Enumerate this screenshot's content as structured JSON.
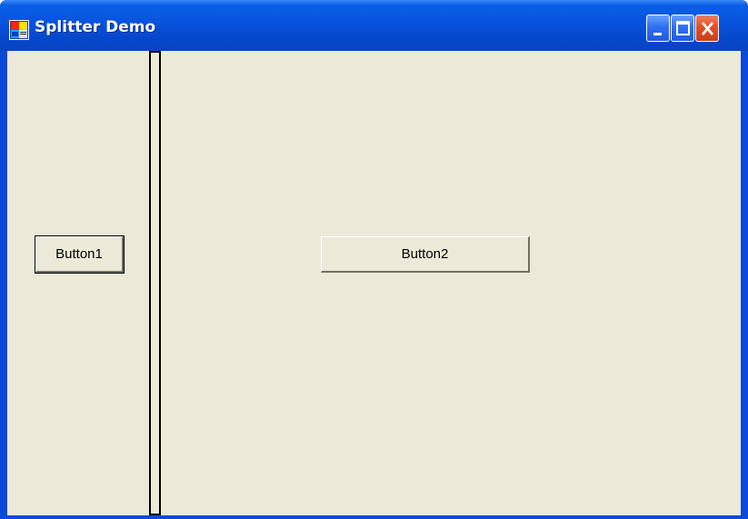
{
  "window": {
    "title": "Splitter Demo",
    "icon": "app-window-icon",
    "controls": {
      "minimize": "minimize-icon",
      "maximize": "maximize-icon",
      "close": "close-icon"
    }
  },
  "left_panel": {
    "button_label": "Button1"
  },
  "right_panel": {
    "button_label": "Button2"
  },
  "colors": {
    "titlebar": "#0853de",
    "client_background": "#ece9d8",
    "close_button": "#e0502a"
  }
}
